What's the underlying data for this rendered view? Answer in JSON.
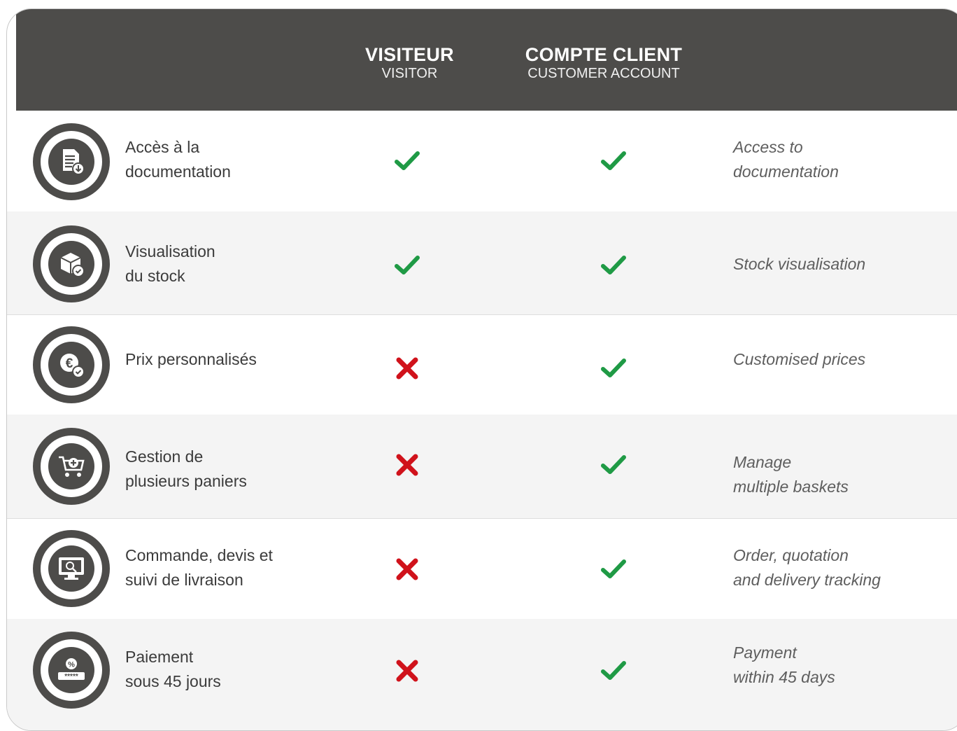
{
  "header": {
    "visitor": {
      "title": "VISITEUR",
      "subtitle": "VISITOR"
    },
    "client": {
      "title": "COMPTE CLIENT",
      "subtitle": "CUSTOMER ACCOUNT"
    }
  },
  "colors": {
    "header_bg": "#4d4c4a",
    "check": "#1f9a45",
    "cross": "#d0121b"
  },
  "rows": [
    {
      "icon": "document-download-icon",
      "fr": [
        "Accès à la",
        "documentation"
      ],
      "en": [
        "Access to",
        "documentation"
      ],
      "visitor": "check",
      "client": "check"
    },
    {
      "icon": "stock-box-icon",
      "fr": [
        "Visualisation",
        "du stock"
      ],
      "en": [
        "Stock visualisation"
      ],
      "visitor": "check",
      "client": "check"
    },
    {
      "icon": "euro-price-icon",
      "fr": [
        "Prix personnalisés"
      ],
      "en": [
        "Customised prices"
      ],
      "visitor": "cross",
      "client": "check"
    },
    {
      "icon": "shopping-cart-add-icon",
      "fr": [
        "Gestion de",
        "plusieurs paniers"
      ],
      "en": [
        "Manage",
        "multiple baskets"
      ],
      "visitor": "cross",
      "client": "check"
    },
    {
      "icon": "monitor-search-icon",
      "fr": [
        "Commande, devis et",
        "suivi de livraison"
      ],
      "en": [
        "Order, quotation",
        "and delivery tracking"
      ],
      "visitor": "cross",
      "client": "check"
    },
    {
      "icon": "payment-card-icon",
      "fr": [
        "Paiement",
        "sous 45 jours"
      ],
      "en": [
        "Payment",
        "within 45 days"
      ],
      "visitor": "cross",
      "client": "check"
    }
  ]
}
